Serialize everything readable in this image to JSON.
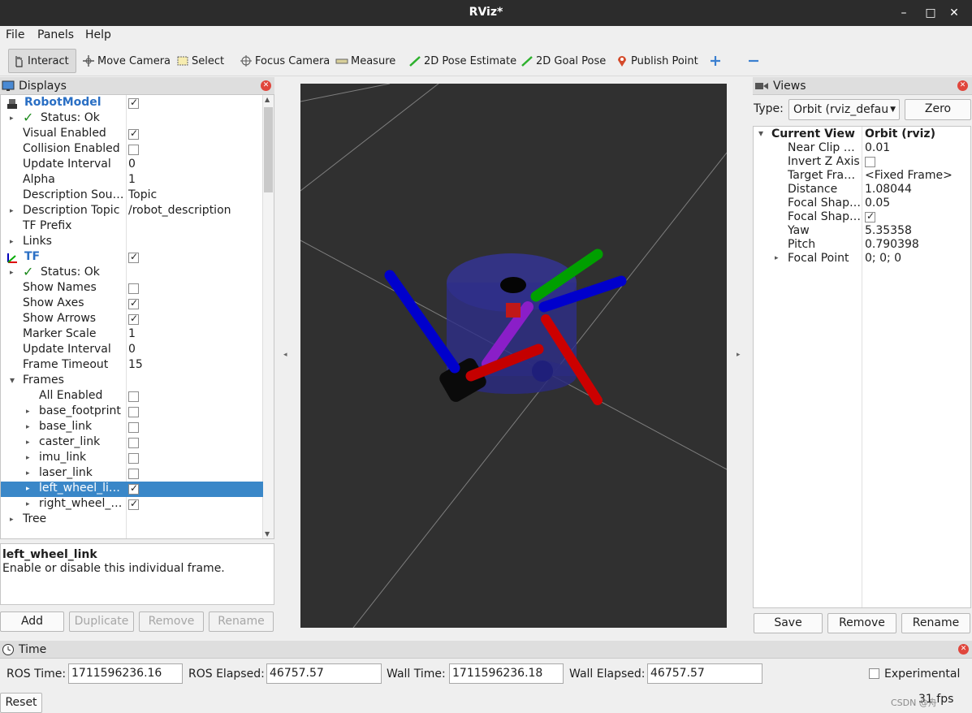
{
  "window": {
    "title": "RViz*"
  },
  "menu": {
    "file": "File",
    "panels": "Panels",
    "help": "Help"
  },
  "toolbar": {
    "interact": "Interact",
    "move_camera": "Move Camera",
    "select": "Select",
    "focus_camera": "Focus Camera",
    "measure": "Measure",
    "pose_estimate": "2D Pose Estimate",
    "goal_pose": "2D Goal Pose",
    "publish_point": "Publish Point"
  },
  "displays": {
    "title": "Displays",
    "rows": [
      {
        "label": "RobotModel",
        "value": ""
      },
      {
        "label": "Status: Ok",
        "value": ""
      },
      {
        "label": "Visual Enabled",
        "value": ""
      },
      {
        "label": "Collision Enabled",
        "value": ""
      },
      {
        "label": "Update Interval",
        "value": "0"
      },
      {
        "label": "Alpha",
        "value": "1"
      },
      {
        "label": "Description Sou…",
        "value": "Topic"
      },
      {
        "label": "Description Topic",
        "value": "/robot_description"
      },
      {
        "label": "TF Prefix",
        "value": ""
      },
      {
        "label": "Links",
        "value": ""
      },
      {
        "label": "TF",
        "value": ""
      },
      {
        "label": "Status: Ok",
        "value": ""
      },
      {
        "label": "Show Names",
        "value": ""
      },
      {
        "label": "Show Axes",
        "value": ""
      },
      {
        "label": "Show Arrows",
        "value": ""
      },
      {
        "label": "Marker Scale",
        "value": "1"
      },
      {
        "label": "Update Interval",
        "value": "0"
      },
      {
        "label": "Frame Timeout",
        "value": "15"
      },
      {
        "label": "Frames",
        "value": ""
      },
      {
        "label": "All Enabled",
        "value": ""
      },
      {
        "label": "base_footprint",
        "value": ""
      },
      {
        "label": "base_link",
        "value": ""
      },
      {
        "label": "caster_link",
        "value": ""
      },
      {
        "label": "imu_link",
        "value": ""
      },
      {
        "label": "laser_link",
        "value": ""
      },
      {
        "label": "left_wheel_li…",
        "value": ""
      },
      {
        "label": "right_wheel_…",
        "value": ""
      },
      {
        "label": "Tree",
        "value": ""
      }
    ],
    "description_title": "left_wheel_link",
    "description_text": "Enable or disable this individual frame.",
    "buttons": {
      "add": "Add",
      "duplicate": "Duplicate",
      "remove": "Remove",
      "rename": "Rename"
    }
  },
  "views": {
    "title": "Views",
    "type_label": "Type:",
    "type_value": "Orbit (rviz_defau",
    "zero": "Zero",
    "rows": [
      {
        "label": "Current View",
        "value": "Orbit (rviz)"
      },
      {
        "label": "Near Clip …",
        "value": "0.01"
      },
      {
        "label": "Invert Z Axis",
        "value": ""
      },
      {
        "label": "Target Fra…",
        "value": "<Fixed Frame>"
      },
      {
        "label": "Distance",
        "value": "1.08044"
      },
      {
        "label": "Focal Shap…",
        "value": "0.05"
      },
      {
        "label": "Focal Shap…",
        "value": ""
      },
      {
        "label": "Yaw",
        "value": "5.35358"
      },
      {
        "label": "Pitch",
        "value": "0.790398"
      },
      {
        "label": "Focal Point",
        "value": "0; 0; 0"
      }
    ],
    "buttons": {
      "save": "Save",
      "remove": "Remove",
      "rename": "Rename"
    }
  },
  "time": {
    "title": "Time",
    "ros_time_label": "ROS Time:",
    "ros_time": "1711596236.16",
    "ros_elapsed_label": "ROS Elapsed:",
    "ros_elapsed": "46757.57",
    "wall_time_label": "Wall Time:",
    "wall_time": "1711596236.18",
    "wall_elapsed_label": "Wall Elapsed:",
    "wall_elapsed": "46757.57",
    "experimental": "Experimental",
    "reset": "Reset",
    "fps": "31 fps",
    "watermark": "CSDN @舟"
  }
}
